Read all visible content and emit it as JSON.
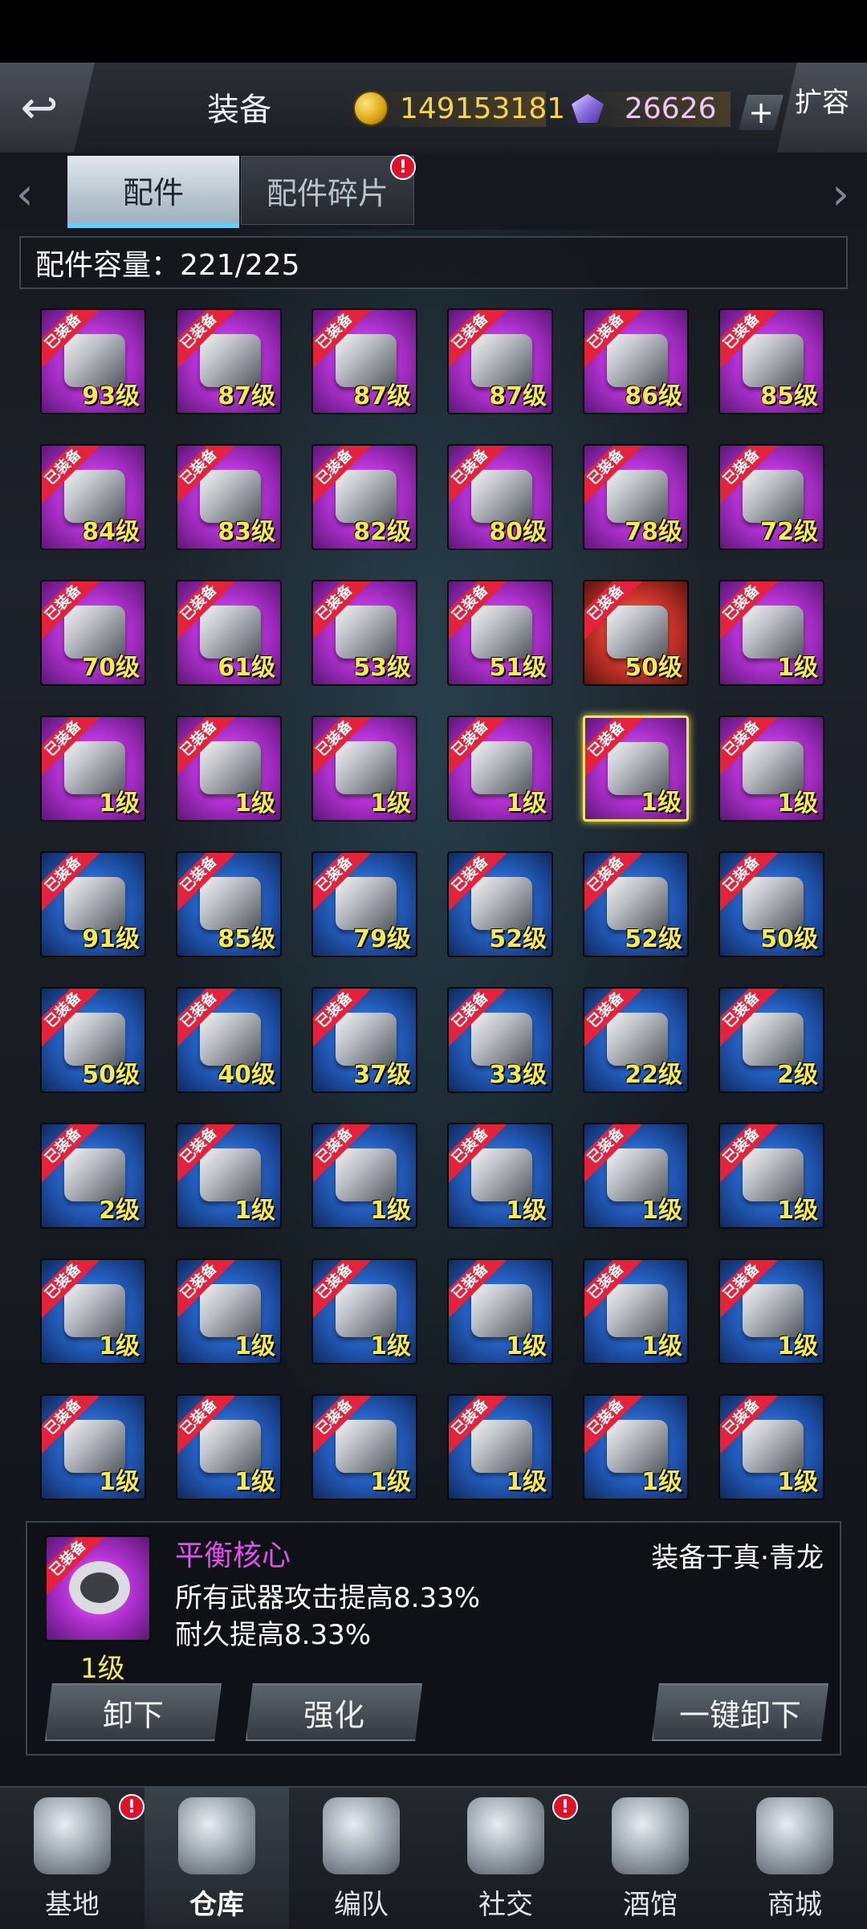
{
  "header": {
    "back_icon": "back-arrow-icon",
    "title": "装备",
    "coins": "149153181",
    "gems": "26626",
    "plus_label": "+",
    "expand_label": "扩容"
  },
  "tabs": {
    "left_arrow": "‹",
    "right_arrow": "›",
    "items": [
      {
        "label": "配件",
        "active": true
      },
      {
        "label": "配件碎片",
        "active": false,
        "badge": "!"
      }
    ]
  },
  "capacity": "配件容量：221/225",
  "ribbon_label": "已装备",
  "items": [
    {
      "level": "93级",
      "color": "purple"
    },
    {
      "level": "87级",
      "color": "purple"
    },
    {
      "level": "87级",
      "color": "purple"
    },
    {
      "level": "87级",
      "color": "purple"
    },
    {
      "level": "86级",
      "color": "purple"
    },
    {
      "level": "85级",
      "color": "purple"
    },
    {
      "level": "84级",
      "color": "purple"
    },
    {
      "level": "83级",
      "color": "purple"
    },
    {
      "level": "82级",
      "color": "purple"
    },
    {
      "level": "80级",
      "color": "purple"
    },
    {
      "level": "78级",
      "color": "purple"
    },
    {
      "level": "72级",
      "color": "purple"
    },
    {
      "level": "70级",
      "color": "purple"
    },
    {
      "level": "61级",
      "color": "purple"
    },
    {
      "level": "53级",
      "color": "purple"
    },
    {
      "level": "51级",
      "color": "purple"
    },
    {
      "level": "50级",
      "color": "red"
    },
    {
      "level": "1级",
      "color": "purple"
    },
    {
      "level": "1级",
      "color": "purple"
    },
    {
      "level": "1级",
      "color": "purple"
    },
    {
      "level": "1级",
      "color": "purple"
    },
    {
      "level": "1级",
      "color": "purple"
    },
    {
      "level": "1级",
      "color": "purple",
      "selected": true
    },
    {
      "level": "1级",
      "color": "purple"
    },
    {
      "level": "91级",
      "color": "blue"
    },
    {
      "level": "85级",
      "color": "blue"
    },
    {
      "level": "79级",
      "color": "blue"
    },
    {
      "level": "52级",
      "color": "blue"
    },
    {
      "level": "52级",
      "color": "blue"
    },
    {
      "level": "50级",
      "color": "blue"
    },
    {
      "level": "50级",
      "color": "blue"
    },
    {
      "level": "40级",
      "color": "blue"
    },
    {
      "level": "37级",
      "color": "blue"
    },
    {
      "level": "33级",
      "color": "blue"
    },
    {
      "level": "22级",
      "color": "blue"
    },
    {
      "level": "2级",
      "color": "blue"
    },
    {
      "level": "2级",
      "color": "blue"
    },
    {
      "level": "1级",
      "color": "blue"
    },
    {
      "level": "1级",
      "color": "blue"
    },
    {
      "level": "1级",
      "color": "blue"
    },
    {
      "level": "1级",
      "color": "blue"
    },
    {
      "level": "1级",
      "color": "blue"
    },
    {
      "level": "1级",
      "color": "blue"
    },
    {
      "level": "1级",
      "color": "blue"
    },
    {
      "level": "1级",
      "color": "blue"
    },
    {
      "level": "1级",
      "color": "blue"
    },
    {
      "level": "1级",
      "color": "blue"
    },
    {
      "level": "1级",
      "color": "blue"
    },
    {
      "level": "1级",
      "color": "blue"
    },
    {
      "level": "1级",
      "color": "blue"
    },
    {
      "level": "1级",
      "color": "blue"
    },
    {
      "level": "1级",
      "color": "blue"
    },
    {
      "level": "1级",
      "color": "blue"
    },
    {
      "level": "1级",
      "color": "blue"
    }
  ],
  "detail": {
    "name": "平衡核心",
    "level": "1级",
    "equipped_on": "装备于真·青龙",
    "effects": [
      "所有武器攻击提高8.33%",
      "耐久提高8.33%"
    ],
    "buttons": {
      "unequip": "卸下",
      "enhance": "强化",
      "unequip_all": "一键卸下"
    }
  },
  "bottom_nav": [
    {
      "label": "基地",
      "icon": "base-icon",
      "badge": "!"
    },
    {
      "label": "仓库",
      "icon": "warehouse-icon",
      "active": true
    },
    {
      "label": "编队",
      "icon": "formation-icon"
    },
    {
      "label": "社交",
      "icon": "social-icon",
      "badge": "!"
    },
    {
      "label": "酒馆",
      "icon": "tavern-icon"
    },
    {
      "label": "商城",
      "icon": "shop-icon"
    }
  ]
}
